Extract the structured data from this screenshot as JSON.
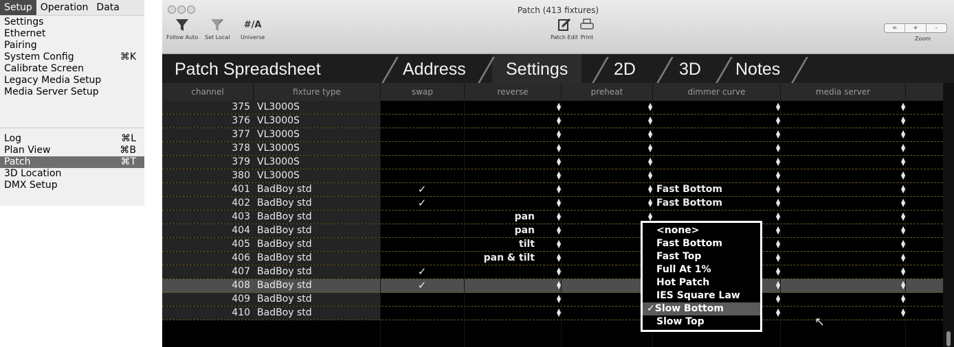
{
  "menu": {
    "bar": [
      "Setup",
      "Operation",
      "Data"
    ],
    "items": [
      {
        "label": "Settings",
        "shortcut": ""
      },
      {
        "label": "Ethernet",
        "shortcut": ""
      },
      {
        "label": "Pairing",
        "shortcut": ""
      },
      {
        "label": "System Config",
        "shortcut": "⌘K"
      },
      {
        "label": "Calibrate Screen",
        "shortcut": ""
      },
      {
        "label": "Legacy Media Setup",
        "shortcut": ""
      },
      {
        "label": "Media Server Setup",
        "shortcut": ""
      },
      {
        "label": "Log",
        "shortcut": "⌘L"
      },
      {
        "label": "Plan View",
        "shortcut": "⌘B"
      },
      {
        "label": "Patch",
        "shortcut": "⌘T"
      },
      {
        "label": "3D Location",
        "shortcut": ""
      },
      {
        "label": "DMX Setup",
        "shortcut": ""
      }
    ]
  },
  "window": {
    "title": "Patch (413 fixtures)",
    "toolbar": {
      "follow_auto": "Follow Auto",
      "set_local": "Set Local",
      "universe": "Universe",
      "universe_glyph": "#/A",
      "patch_edit": "Patch Edit",
      "print": "Print",
      "zoom_label": "Zoom",
      "zoom_buttons": [
        "=",
        "+",
        "-"
      ]
    },
    "tabs": [
      "Patch Spreadsheet",
      "Address",
      "Settings",
      "2D",
      "3D",
      "Notes"
    ],
    "active_tab": "Settings"
  },
  "grid": {
    "headers": [
      "channel",
      "fixture type",
      "swap",
      "reverse",
      "preheat",
      "dimmer curve",
      "media server"
    ],
    "rows": [
      {
        "channel": "375",
        "fixture": "VL3000S",
        "swap": "",
        "reverse": "",
        "dimmer": ""
      },
      {
        "channel": "376",
        "fixture": "VL3000S",
        "swap": "",
        "reverse": "",
        "dimmer": ""
      },
      {
        "channel": "377",
        "fixture": "VL3000S",
        "swap": "",
        "reverse": "",
        "dimmer": ""
      },
      {
        "channel": "378",
        "fixture": "VL3000S",
        "swap": "",
        "reverse": "",
        "dimmer": ""
      },
      {
        "channel": "379",
        "fixture": "VL3000S",
        "swap": "",
        "reverse": "",
        "dimmer": ""
      },
      {
        "channel": "380",
        "fixture": "VL3000S",
        "swap": "",
        "reverse": "",
        "dimmer": ""
      },
      {
        "channel": "401",
        "fixture": "BadBoy std",
        "swap": "✓",
        "reverse": "",
        "dimmer": "Fast Bottom"
      },
      {
        "channel": "402",
        "fixture": "BadBoy std",
        "swap": "✓",
        "reverse": "",
        "dimmer": "Fast Bottom"
      },
      {
        "channel": "403",
        "fixture": "BadBoy std",
        "swap": "",
        "reverse": "pan",
        "dimmer": ""
      },
      {
        "channel": "404",
        "fixture": "BadBoy std",
        "swap": "",
        "reverse": "pan",
        "dimmer": ""
      },
      {
        "channel": "405",
        "fixture": "BadBoy std",
        "swap": "",
        "reverse": "tilt",
        "dimmer": ""
      },
      {
        "channel": "406",
        "fixture": "BadBoy std",
        "swap": "",
        "reverse": "pan & tilt",
        "dimmer": ""
      },
      {
        "channel": "407",
        "fixture": "BadBoy std",
        "swap": "✓",
        "reverse": "",
        "dimmer": ""
      },
      {
        "channel": "408",
        "fixture": "BadBoy std",
        "swap": "✓",
        "reverse": "",
        "dimmer": ""
      },
      {
        "channel": "409",
        "fixture": "BadBoy std",
        "swap": "",
        "reverse": "",
        "dimmer": ""
      },
      {
        "channel": "410",
        "fixture": "BadBoy std",
        "swap": "",
        "reverse": "",
        "dimmer": ""
      }
    ]
  },
  "dropdown": {
    "options": [
      "<none>",
      "Fast Bottom",
      "Fast Top",
      "Full At 1%",
      "Hot Patch",
      "IES Square Law",
      "Slow Bottom",
      "Slow Top"
    ],
    "selected": "Slow Bottom",
    "check_glyph": "✓"
  }
}
